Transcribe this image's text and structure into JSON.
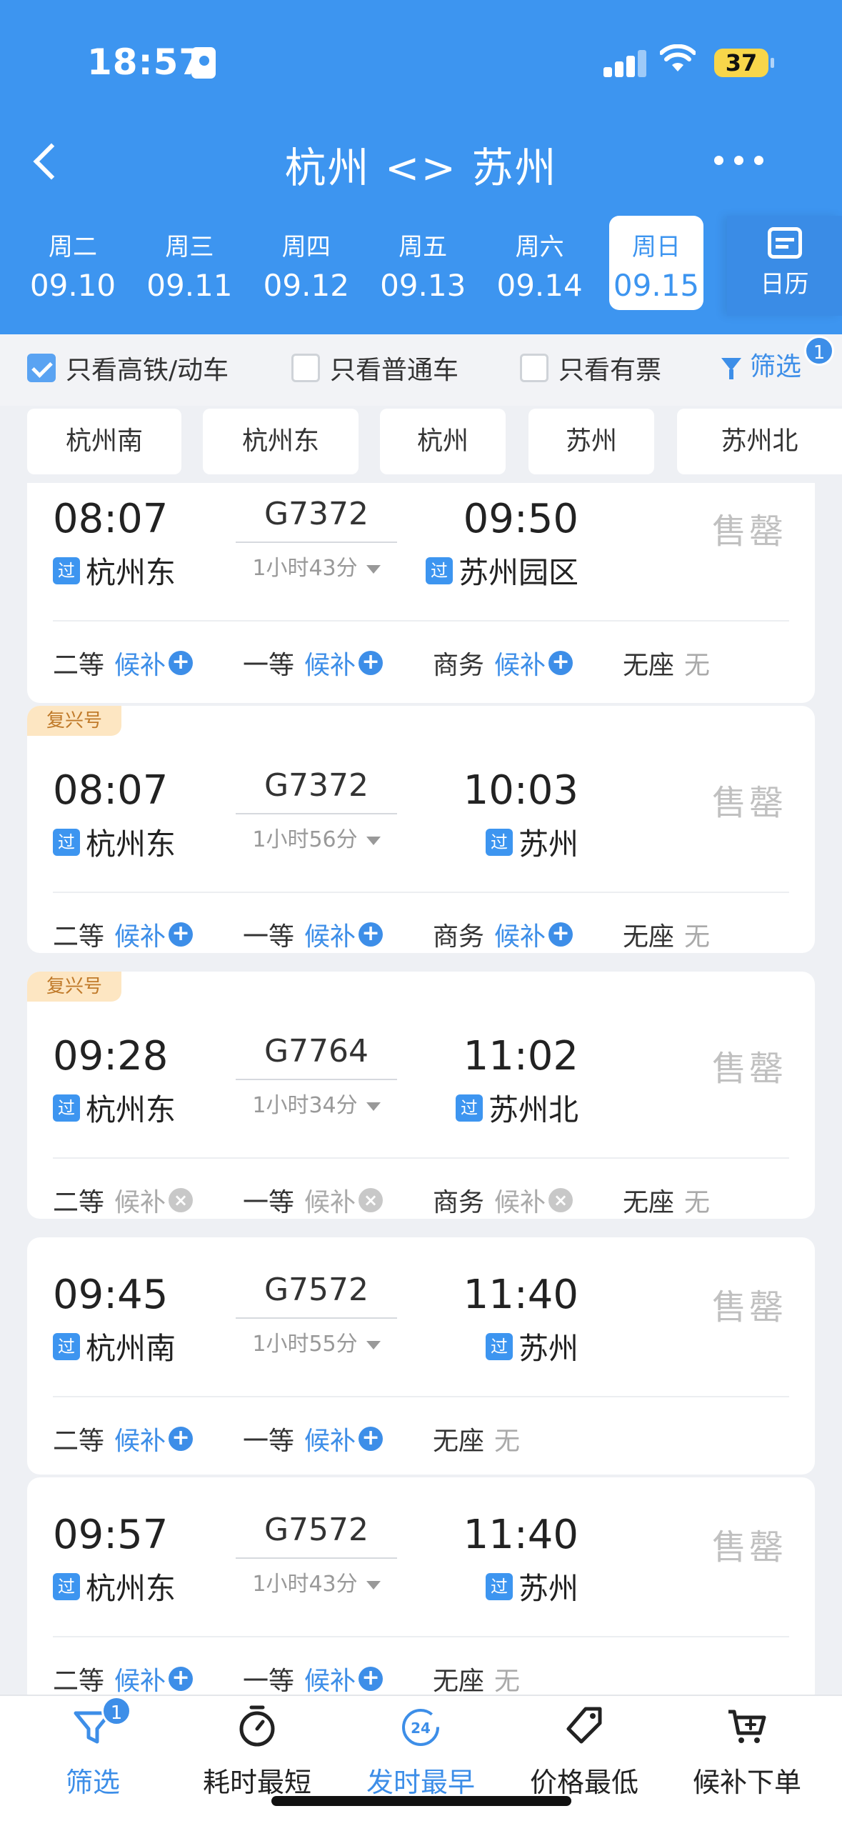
{
  "status_bar": {
    "time": "18:57",
    "battery": "37"
  },
  "header": {
    "title": "杭州 <> 苏州"
  },
  "dates": [
    {
      "weekday": "周二",
      "date": "09.10",
      "active": false
    },
    {
      "weekday": "周三",
      "date": "09.11",
      "active": false
    },
    {
      "weekday": "周四",
      "date": "09.12",
      "active": false
    },
    {
      "weekday": "周五",
      "date": "09.13",
      "active": false
    },
    {
      "weekday": "周六",
      "date": "09.14",
      "active": false
    },
    {
      "weekday": "周日",
      "date": "09.15",
      "active": true
    }
  ],
  "calendar_label": "日历",
  "filters": {
    "high_speed": "只看高铁/动车",
    "normal": "只看普通车",
    "available": "只看有票",
    "filter_label": "筛选",
    "filter_count": "1"
  },
  "stations": [
    "杭州南",
    "杭州东",
    "杭州",
    "苏州",
    "苏州北"
  ],
  "pass_label": "过",
  "fuxing_label": "复兴号",
  "soldout_label": "售罄",
  "trains": [
    {
      "dep_time": "08:07",
      "train_no": "G7372",
      "duration": "1小时43分",
      "arr_time": "09:50",
      "dep_station": "杭州东",
      "arr_station": "苏州园区",
      "seats": [
        {
          "name": "二等",
          "value": "候补",
          "icon": "plus"
        },
        {
          "name": "一等",
          "value": "候补",
          "icon": "plus"
        },
        {
          "name": "商务",
          "value": "候补",
          "icon": "plus"
        },
        {
          "name": "无座",
          "value": "无",
          "icon": "none"
        }
      ]
    },
    {
      "dep_time": "08:07",
      "train_no": "G7372",
      "duration": "1小时56分",
      "arr_time": "10:03",
      "dep_station": "杭州东",
      "arr_station": "苏州",
      "seats": [
        {
          "name": "二等",
          "value": "候补",
          "icon": "plus"
        },
        {
          "name": "一等",
          "value": "候补",
          "icon": "plus"
        },
        {
          "name": "商务",
          "value": "候补",
          "icon": "plus"
        },
        {
          "name": "无座",
          "value": "无",
          "icon": "none"
        }
      ]
    },
    {
      "dep_time": "09:28",
      "train_no": "G7764",
      "duration": "1小时34分",
      "arr_time": "11:02",
      "dep_station": "杭州东",
      "arr_station": "苏州北",
      "seats": [
        {
          "name": "二等",
          "value": "候补",
          "icon": "x"
        },
        {
          "name": "一等",
          "value": "候补",
          "icon": "x"
        },
        {
          "name": "商务",
          "value": "候补",
          "icon": "x"
        },
        {
          "name": "无座",
          "value": "无",
          "icon": "none"
        }
      ]
    },
    {
      "dep_time": "09:45",
      "train_no": "G7572",
      "duration": "1小时55分",
      "arr_time": "11:40",
      "dep_station": "杭州南",
      "arr_station": "苏州",
      "seats": [
        {
          "name": "二等",
          "value": "候补",
          "icon": "plus"
        },
        {
          "name": "一等",
          "value": "候补",
          "icon": "plus"
        },
        {
          "name": "无座",
          "value": "无",
          "icon": "none"
        }
      ]
    },
    {
      "dep_time": "09:57",
      "train_no": "G7572",
      "duration": "1小时43分",
      "arr_time": "11:40",
      "dep_station": "杭州东",
      "arr_station": "苏州",
      "seats": [
        {
          "name": "二等",
          "value": "候补",
          "icon": "plus"
        },
        {
          "name": "一等",
          "value": "候补",
          "icon": "plus"
        },
        {
          "name": "无座",
          "value": "无",
          "icon": "none"
        }
      ]
    }
  ],
  "bottom_bar": {
    "filter": "筛选",
    "filter_count": "1",
    "shortest": "耗时最短",
    "earliest": "发时最早",
    "earliest_icon_text": "24",
    "cheapest": "价格最低",
    "waitlist": "候补下单"
  },
  "colors": {
    "primary": "#3d95f0",
    "accent": "#3d8ee8",
    "fuxing_bg": "#fde6c2",
    "soldout": "#c0c0c0"
  }
}
